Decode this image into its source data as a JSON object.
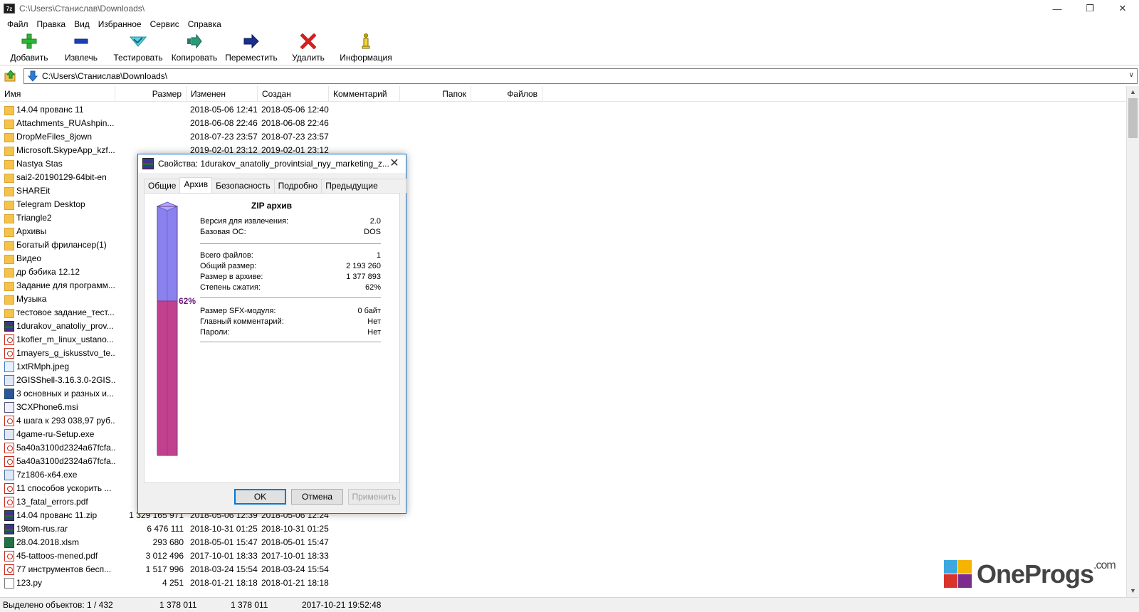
{
  "window": {
    "app_icon": "7z",
    "title": "C:\\Users\\Станислав\\Downloads\\",
    "controls": [
      "minimize-icon",
      "restore-icon",
      "close-icon"
    ]
  },
  "menu": [
    "Файл",
    "Правка",
    "Вид",
    "Избранное",
    "Сервис",
    "Справка"
  ],
  "toolbar": [
    {
      "label": "Добавить",
      "icon": "plus-icon",
      "color": "#2fb536"
    },
    {
      "label": "Извлечь",
      "icon": "minus-icon",
      "color": "#1a3fb8"
    },
    {
      "label": "Тестировать",
      "icon": "check-icon",
      "color": "#35b7c9"
    },
    {
      "label": "Копировать",
      "icon": "copy-arrow-icon",
      "color": "#2a7a6a"
    },
    {
      "label": "Переместить",
      "icon": "move-arrow-icon",
      "color": "#1a2f8f"
    },
    {
      "label": "Удалить",
      "icon": "delete-x-icon",
      "color": "#d3201f"
    },
    {
      "label": "Информация",
      "icon": "info-icon",
      "color": "#c8a800"
    }
  ],
  "address": {
    "path": "C:\\Users\\Станислав\\Downloads\\"
  },
  "columns": [
    "Имя",
    "Размер",
    "Изменен",
    "Создан",
    "Комментарий",
    "Папок",
    "Файлов"
  ],
  "files": [
    {
      "name": "14.04 прованс 11",
      "size": "",
      "modified": "2018-05-06 12:41",
      "created": "2018-05-06 12:40",
      "type": "folder"
    },
    {
      "name": "Attachments_RUAshpin...",
      "size": "",
      "modified": "2018-06-08 22:46",
      "created": "2018-06-08 22:46",
      "type": "folder"
    },
    {
      "name": "DropMeFiles_8jown",
      "size": "",
      "modified": "2018-07-23 23:57",
      "created": "2018-07-23 23:57",
      "type": "folder"
    },
    {
      "name": "Microsoft.SkypeApp_kzf...",
      "size": "",
      "modified": "2019-02-01 23:12",
      "created": "2019-02-01 23:12",
      "type": "folder"
    },
    {
      "name": "Nastya Stas",
      "size": "",
      "modified": "",
      "created": "",
      "type": "folder"
    },
    {
      "name": "sai2-20190129-64bit-en",
      "size": "",
      "modified": "",
      "created": "",
      "type": "folder"
    },
    {
      "name": "SHAREit",
      "size": "",
      "modified": "",
      "created": "",
      "type": "folder"
    },
    {
      "name": "Telegram Desktop",
      "size": "",
      "modified": "",
      "created": "",
      "type": "folder"
    },
    {
      "name": "Triangle2",
      "size": "",
      "modified": "",
      "created": "",
      "type": "folder"
    },
    {
      "name": "Архивы",
      "size": "",
      "modified": "",
      "created": "",
      "type": "folder"
    },
    {
      "name": "Богатый фрилансер(1)",
      "size": "",
      "modified": "",
      "created": "",
      "type": "folder"
    },
    {
      "name": "Видео",
      "size": "",
      "modified": "",
      "created": "",
      "type": "folder"
    },
    {
      "name": "др бэбика 12.12",
      "size": "",
      "modified": "",
      "created": "",
      "type": "folder"
    },
    {
      "name": "Задание для программ...",
      "size": "",
      "modified": "",
      "created": "",
      "type": "folder"
    },
    {
      "name": "Музыка",
      "size": "",
      "modified": "",
      "created": "",
      "type": "folder"
    },
    {
      "name": "тестовое задание_тест...",
      "size": "",
      "modified": "",
      "created": "",
      "type": "folder"
    },
    {
      "name": "1durakov_anatoliy_prov...",
      "size": "",
      "modified": "",
      "created": "",
      "type": "archive"
    },
    {
      "name": "1kofler_m_linux_ustano...",
      "size": "",
      "modified": "",
      "created": "",
      "type": "pdf"
    },
    {
      "name": "1mayers_g_iskusstvo_te...",
      "size": "",
      "modified": "",
      "created": "",
      "type": "pdf"
    },
    {
      "name": "1xtRMph.jpeg",
      "size": "",
      "modified": "",
      "created": "",
      "type": "img"
    },
    {
      "name": "2GISShell-3.16.3.0-2GIS...",
      "size": "",
      "modified": "",
      "created": "",
      "type": "exe"
    },
    {
      "name": "3 основных и разных и...",
      "size": "",
      "modified": "",
      "created": "",
      "type": "word"
    },
    {
      "name": "3CXPhone6.msi",
      "size": "",
      "modified": "",
      "created": "",
      "type": "msi"
    },
    {
      "name": "4 шага к 293 038,97 руб...",
      "size": "",
      "modified": "",
      "created": "",
      "type": "pdf"
    },
    {
      "name": "4game-ru-Setup.exe",
      "size": "",
      "modified": "",
      "created": "",
      "type": "exe"
    },
    {
      "name": "5a40a3100d2324a67fcfa...",
      "size": "",
      "modified": "",
      "created": "",
      "type": "pdf"
    },
    {
      "name": "5a40a3100d2324a67fcfa...",
      "size": "",
      "modified": "",
      "created": "",
      "type": "pdf"
    },
    {
      "name": "7z1806-x64.exe",
      "size": "",
      "modified": "",
      "created": "",
      "type": "exe"
    },
    {
      "name": "11 способов ускорить ...",
      "size": "",
      "modified": "",
      "created": "",
      "type": "pdf"
    },
    {
      "name": "13_fatal_errors.pdf",
      "size": "",
      "modified": "",
      "created": "",
      "type": "pdf"
    },
    {
      "name": "14.04 прованс 11.zip",
      "size": "1 329 165 971",
      "modified": "2018-05-06 12:39",
      "created": "2018-05-06 12:24",
      "type": "archive"
    },
    {
      "name": "19tom-rus.rar",
      "size": "6 476 111",
      "modified": "2018-10-31 01:25",
      "created": "2018-10-31 01:25",
      "type": "archive"
    },
    {
      "name": "28.04.2018.xlsm",
      "size": "293 680",
      "modified": "2018-05-01 15:47",
      "created": "2018-05-01 15:47",
      "type": "excel"
    },
    {
      "name": "45-tattoos-mened.pdf",
      "size": "3 012 496",
      "modified": "2017-10-01 18:33",
      "created": "2017-10-01 18:33",
      "type": "pdf"
    },
    {
      "name": "77 инструментов бесп...",
      "size": "1 517 996",
      "modified": "2018-03-24 15:54",
      "created": "2018-03-24 15:54",
      "type": "pdf"
    },
    {
      "name": "123.py",
      "size": "4 251",
      "modified": "2018-01-21 18:18",
      "created": "2018-01-21 18:18",
      "type": "file"
    }
  ],
  "status": {
    "selected": "Выделено объектов: 1 / 432",
    "size": "1 378 011",
    "packed": "1 378 011",
    "date": "2017-10-21 19:52:48"
  },
  "watermark": {
    "brand": "OneProgs",
    "suffix": ".com",
    "colors": [
      "#3da8e0",
      "#f4b400",
      "#d9342b",
      "#7a2d8c"
    ]
  },
  "dialog": {
    "title": "Свойства: 1durakov_anatoliy_provintsial_nyy_marketing_z...",
    "tabs": [
      "Общие",
      "Архив",
      "Безопасность",
      "Подробно",
      "Предыдущие версии"
    ],
    "active_tab": 1,
    "panel_title": "ZIP архив",
    "group1": [
      {
        "k": "Версия для извлечения:",
        "v": "2.0"
      },
      {
        "k": "Базовая ОС:",
        "v": "DOS"
      }
    ],
    "group2": [
      {
        "k": "Всего файлов:",
        "v": "1"
      },
      {
        "k": "Общий размер:",
        "v": "2 193 260"
      },
      {
        "k": "Размер в архиве:",
        "v": "1 377 893"
      },
      {
        "k": "Степень сжатия:",
        "v": "62%"
      }
    ],
    "group3": [
      {
        "k": "Размер SFX-модуля:",
        "v": "0 байт"
      },
      {
        "k": "Главный комментарий:",
        "v": "Нет"
      },
      {
        "k": "Пароли:",
        "v": "Нет"
      }
    ],
    "ratio_label": "62%",
    "ratio": 0.62,
    "bar_colors": {
      "top": "#8a80ee",
      "bottom": "#c2418f"
    },
    "buttons": {
      "ok": "OK",
      "cancel": "Отмена",
      "apply": "Применить"
    }
  }
}
